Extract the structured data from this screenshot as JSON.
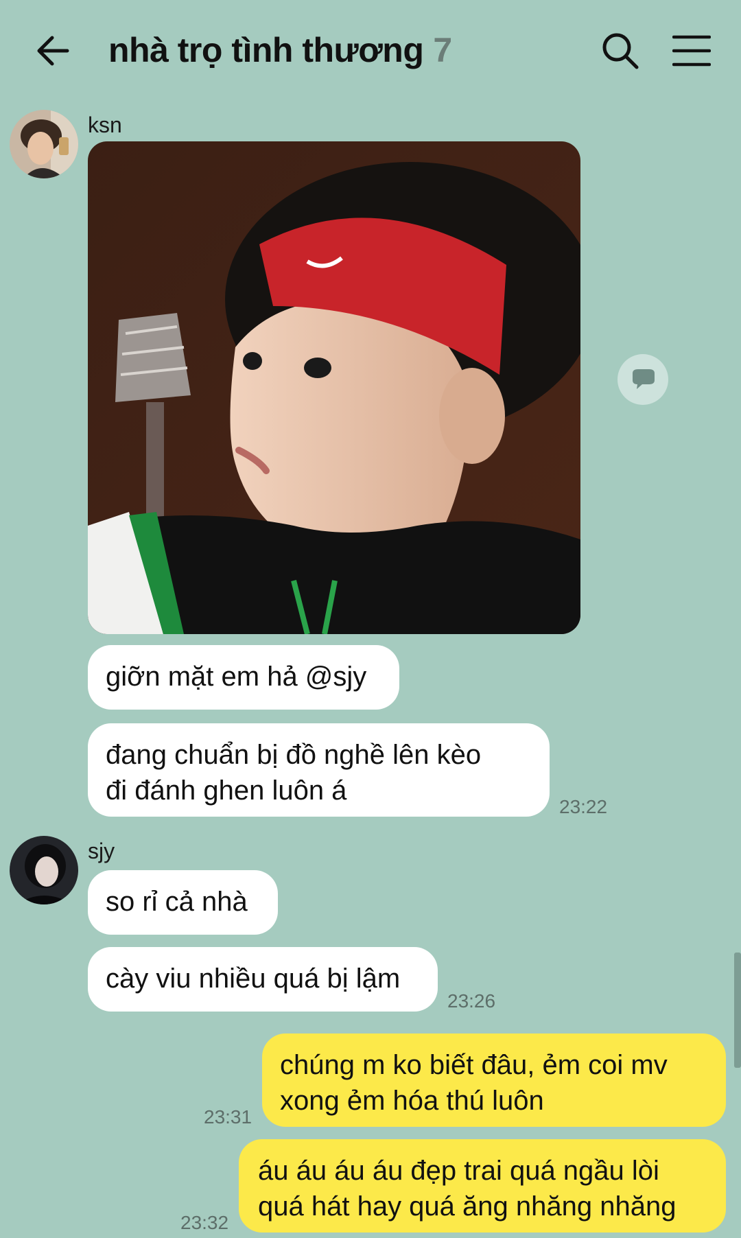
{
  "header": {
    "title": "nhà trọ tình thương",
    "member_count": "7",
    "icons": {
      "back": "arrow-left-icon",
      "search": "search-icon",
      "menu": "hamburger-menu-icon"
    }
  },
  "messages": {
    "ksn": {
      "sender": "ksn",
      "photo_description_icon": "photo",
      "bubble1": "giỡn mặt em hả @sjy",
      "bubble2_line1": "đang chuẩn bị đồ nghề lên kèo",
      "bubble2_line2": "đi đánh ghen luôn á",
      "time": "23:22"
    },
    "sjy": {
      "sender": "sjy",
      "bubble1": "so rỉ cả nhà",
      "bubble2": "cày viu nhiều quá bị lậm",
      "time": "23:26"
    },
    "me": {
      "bubble1_line1": "chúng m ko biết đâu, ẻm coi mv",
      "bubble1_line2": "xong ẻm hóa thú luôn",
      "time1": "23:31",
      "bubble2_line1": "áu áu áu áu đẹp trai quá ngầu lòi",
      "bubble2_line2": "quá hát hay quá ăng nhăng nhăng",
      "time2": "23:32"
    }
  },
  "colors": {
    "background": "#a5cbbf",
    "incoming_bubble": "#ffffff",
    "outgoing_bubble": "#fce94a"
  }
}
